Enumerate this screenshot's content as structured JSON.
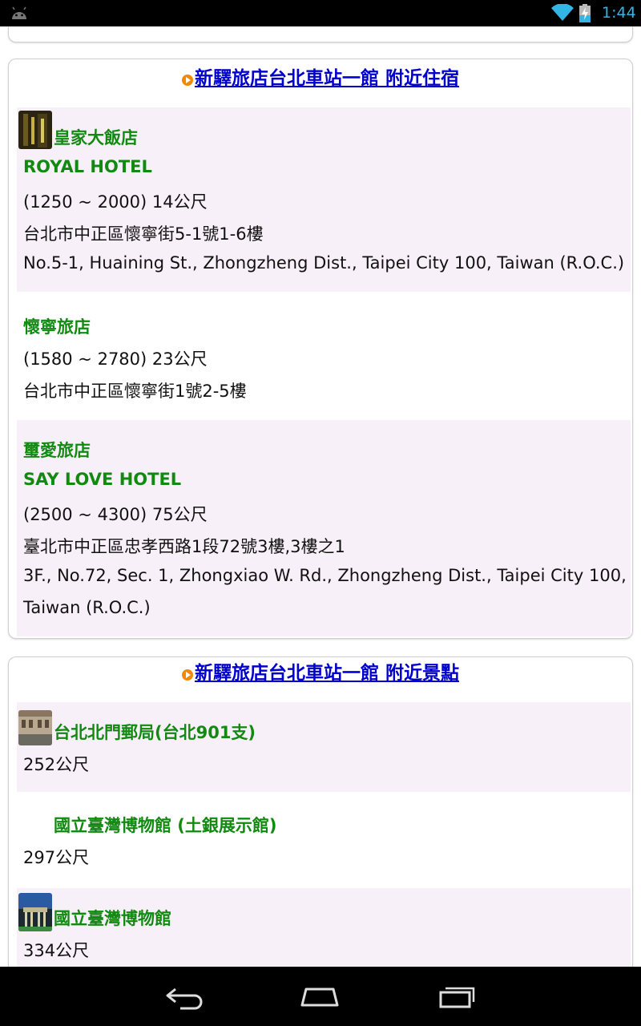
{
  "status_bar": {
    "time": "1:44",
    "icons": [
      "android-icon",
      "wifi-icon",
      "battery-charging-icon"
    ]
  },
  "hotels_section": {
    "title": "新驛旅店台北車站一館 附近住宿",
    "items": [
      {
        "name_zh": "皇家大飯店",
        "name_en": "ROYAL HOTEL",
        "price_distance": "(1250 ~ 2000) 14公尺",
        "address_zh": "台北市中正區懷寧街5-1號1-6樓",
        "address_en": "No.5-1, Huaining St., Zhongzheng Dist., Taipei City 100, Taiwan (R.O.C.)"
      },
      {
        "name_zh": "懷寧旅店",
        "price_distance": "(1580 ~ 2780) 23公尺",
        "address_zh": "台北市中正區懷寧街1號2-5樓"
      },
      {
        "name_zh": "璽愛旅店",
        "name_en": "SAY LOVE HOTEL",
        "price_distance": "(2500 ~ 4300) 75公尺",
        "address_zh": "臺北市中正區忠孝西路1段72號3樓,3樓之1",
        "address_en_1": "3F., No.72, Sec. 1, Zhongxiao W. Rd., Zhongzheng Dist., Taipei City 100,",
        "address_en_2": "Taiwan (R.O.C.)"
      }
    ]
  },
  "sights_section": {
    "title": "新驛旅店台北車站一館 附近景點",
    "items": [
      {
        "name": "台北北門郵局(台北901支)",
        "distance": "252公尺"
      },
      {
        "name": "國立臺灣博物館 (土銀展示館)",
        "distance": "297公尺"
      },
      {
        "name": "國立臺灣博物館",
        "distance": "334公尺"
      }
    ]
  },
  "nav_bar": {
    "buttons": [
      "back-icon",
      "home-icon",
      "recent-apps-icon"
    ]
  },
  "colors": {
    "link_blue": "#0000cc",
    "name_green": "#128a12",
    "shaded_row": "#f8f0f8",
    "status_accent": "#33b5e5"
  }
}
